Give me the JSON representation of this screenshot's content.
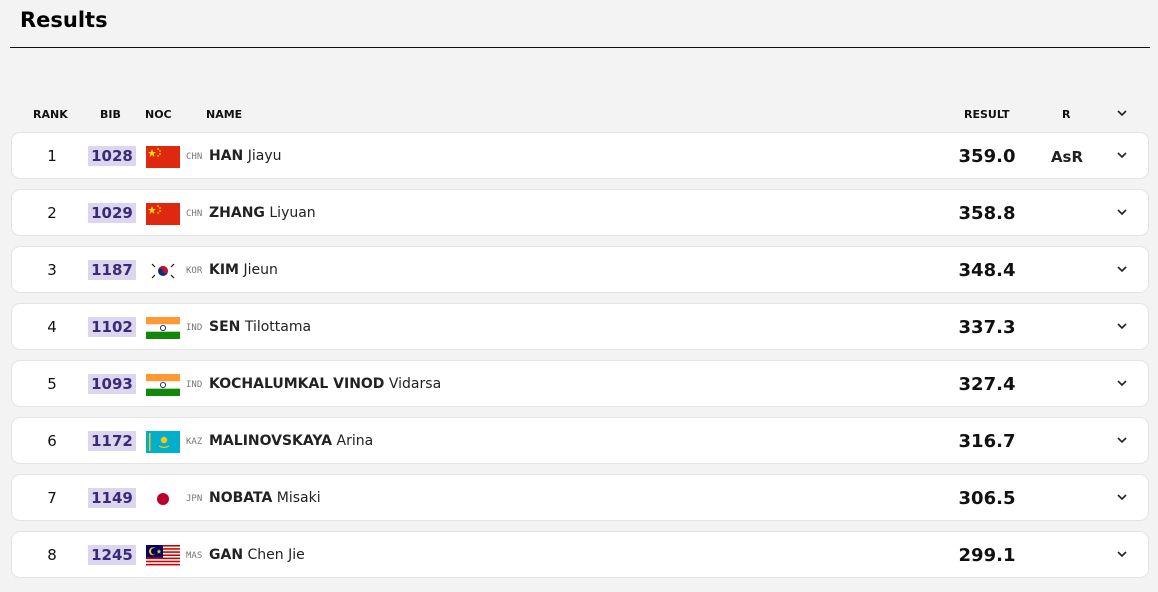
{
  "page": {
    "title": "Results"
  },
  "columns": {
    "rank": "RANK",
    "bib": "BIB",
    "noc": "NOC",
    "name": "NAME",
    "result": "RESULT",
    "record": "R"
  },
  "rows": [
    {
      "rank": "1",
      "bib": "1028",
      "noc": "CHN",
      "flag": "china-flag-icon",
      "surname": "HAN",
      "given": "Jiayu",
      "result": "359.0",
      "record": "AsR"
    },
    {
      "rank": "2",
      "bib": "1029",
      "noc": "CHN",
      "flag": "china-flag-icon",
      "surname": "ZHANG",
      "given": "Liyuan",
      "result": "358.8",
      "record": ""
    },
    {
      "rank": "3",
      "bib": "1187",
      "noc": "KOR",
      "flag": "korea-flag-icon",
      "surname": "KIM",
      "given": "Jieun",
      "result": "348.4",
      "record": ""
    },
    {
      "rank": "4",
      "bib": "1102",
      "noc": "IND",
      "flag": "india-flag-icon",
      "surname": "SEN",
      "given": "Tilottama",
      "result": "337.3",
      "record": ""
    },
    {
      "rank": "5",
      "bib": "1093",
      "noc": "IND",
      "flag": "india-flag-icon",
      "surname": "KOCHALUMKAL VINOD",
      "given": "Vidarsa",
      "result": "327.4",
      "record": ""
    },
    {
      "rank": "6",
      "bib": "1172",
      "noc": "KAZ",
      "flag": "kazakhstan-flag-icon",
      "surname": "MALINOVSKAYA",
      "given": "Arina",
      "result": "316.7",
      "record": ""
    },
    {
      "rank": "7",
      "bib": "1149",
      "noc": "JPN",
      "flag": "japan-flag-icon",
      "surname": "NOBATA",
      "given": "Misaki",
      "result": "306.5",
      "record": ""
    },
    {
      "rank": "8",
      "bib": "1245",
      "noc": "MAS",
      "flag": "malaysia-flag-icon",
      "surname": "GAN",
      "given": "Chen Jie",
      "result": "299.1",
      "record": ""
    }
  ],
  "colors": {
    "bib_bg": "#dcd6ee",
    "bib_text": "#3a2a78",
    "row_bg": "#ffffff",
    "page_bg": "#f3f3f3"
  }
}
